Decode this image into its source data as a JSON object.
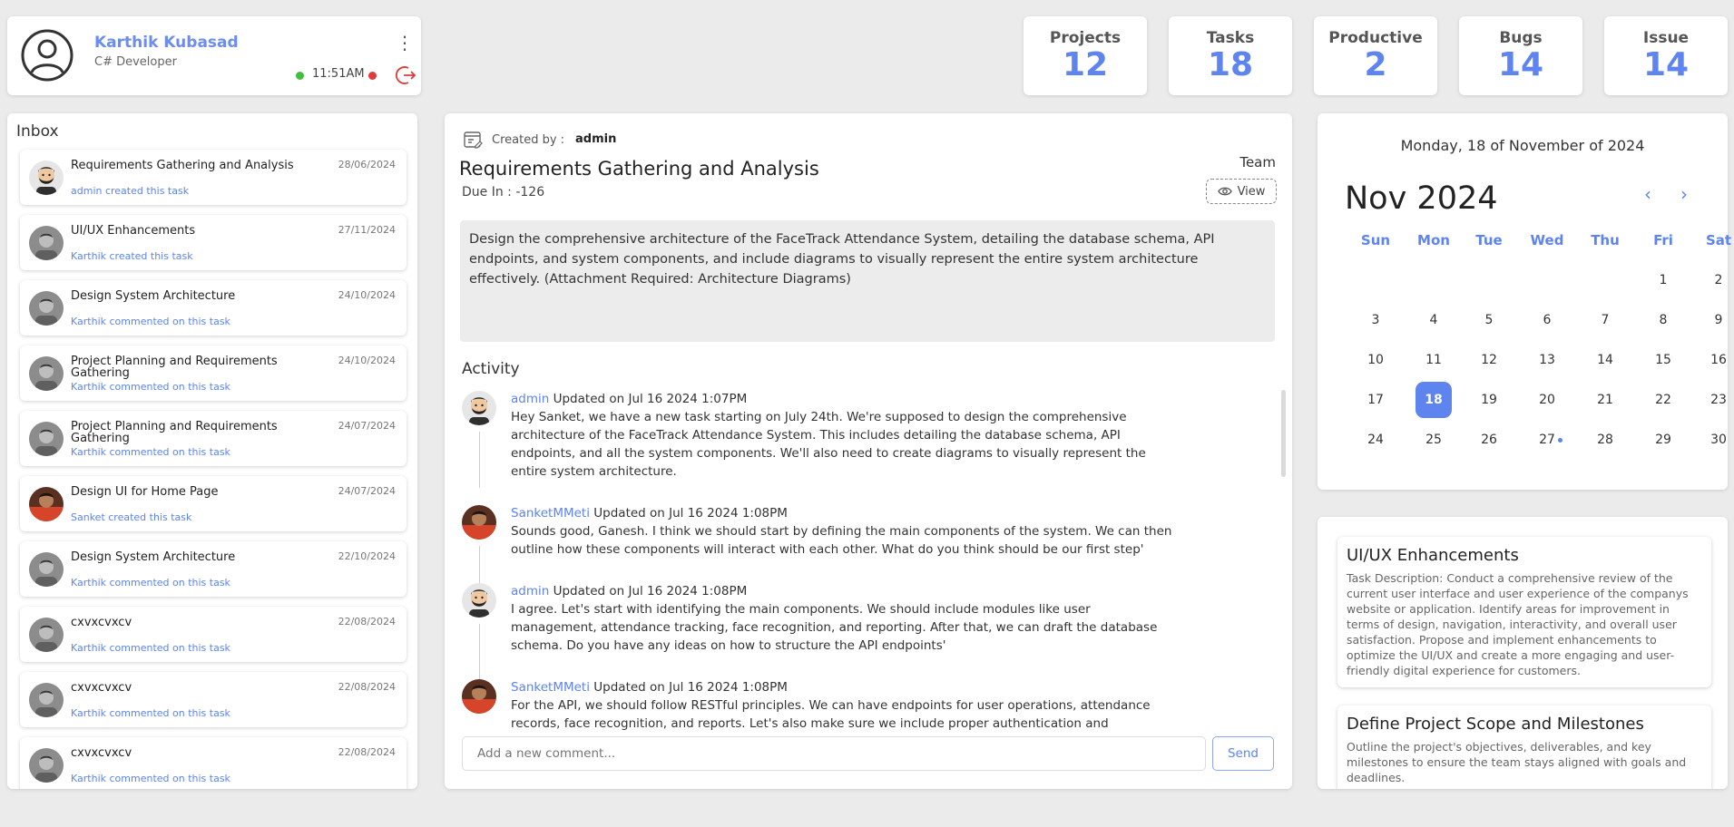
{
  "profile": {
    "name": "Karthik Kubasad",
    "role": "C# Developer",
    "time": "11:51AM"
  },
  "stats": [
    {
      "label": "Projects",
      "value": "12"
    },
    {
      "label": "Tasks",
      "value": "18"
    },
    {
      "label": "Productive",
      "value": "2"
    },
    {
      "label": "Bugs",
      "value": "14"
    },
    {
      "label": "Issue",
      "value": "14"
    }
  ],
  "inbox": {
    "title": "Inbox",
    "items": [
      {
        "title": "Requirements Gathering and Analysis",
        "subtitle": "admin created this task",
        "date": "28/06/2024"
      },
      {
        "title": "UI/UX Enhancements",
        "subtitle": "Karthik created this task",
        "date": "27/11/2024"
      },
      {
        "title": "Design System Architecture",
        "subtitle": "Karthik commented on this task",
        "date": "24/10/2024"
      },
      {
        "title": "Project Planning and Requirements Gathering",
        "subtitle": "Karthik commented on this task",
        "date": "24/10/2024"
      },
      {
        "title": "Project Planning and Requirements Gathering",
        "subtitle": "Karthik commented on this task",
        "date": "24/07/2024"
      },
      {
        "title": "Design UI for Home Page",
        "subtitle": "Sanket created this task",
        "date": "24/07/2024"
      },
      {
        "title": "Design System Architecture",
        "subtitle": "Karthik commented on this task",
        "date": "22/10/2024"
      },
      {
        "title": "cxvxcvxcv",
        "subtitle": "Karthik commented on this task",
        "date": "22/08/2024"
      },
      {
        "title": "cxvxcvxcv",
        "subtitle": "Karthik commented on this task",
        "date": "22/08/2024"
      },
      {
        "title": "cxvxcvxcv",
        "subtitle": "Karthik commented on this task",
        "date": "22/08/2024"
      }
    ]
  },
  "task": {
    "created_label": "Created by :",
    "created_by": "admin",
    "title": "Requirements Gathering and Analysis",
    "due": "Due In : -126",
    "team_label": "Team",
    "view_label": "View",
    "description": "Design the comprehensive architecture of the FaceTrack Attendance System, detailing the database schema, API endpoints, and system components, and include diagrams to visually represent the entire system architecture effectively. (Attachment Required: Architecture Diagrams)",
    "activity_title": "Activity",
    "activity": [
      {
        "user": "admin",
        "meta": " Updated on Jul 16 2024 1:07PM",
        "text": "Hey Sanket, we have a new task starting on July 24th. We're supposed to design the comprehensive architecture of the FaceTrack Attendance System. This includes detailing the database schema, API endpoints, and all the system components. We'll also need to create diagrams to visually represent the entire system architecture."
      },
      {
        "user": "SanketMMeti",
        "meta": " Updated on Jul 16 2024 1:08PM",
        "text": "Sounds good, Ganesh. I think we should start by defining the main components of the system. We can then outline how these components will interact with each other. What do you think should be our first step'"
      },
      {
        "user": "admin",
        "meta": " Updated on Jul 16 2024 1:08PM",
        "text": "I agree. Let's start with identifying the main components. We should include modules like user management, attendance tracking, face recognition, and reporting. After that, we can draft the database schema. Do you have any ideas on how to structure the API endpoints'"
      },
      {
        "user": "SanketMMeti",
        "meta": " Updated on Jul 16 2024 1:08PM",
        "text": "For the API, we should follow RESTful principles. We can have endpoints for user operations, attendance records, face recognition, and reports. Let's also make sure we include proper authentication and authorization mechanisms."
      }
    ],
    "comment_placeholder": "Add a new comment...",
    "send_label": "Send"
  },
  "calendar": {
    "full_date": "Monday, 18 of November of 2024",
    "month_label": "Nov 2024",
    "weekdays": [
      "Sun",
      "Mon",
      "Tue",
      "Wed",
      "Thu",
      "Fri",
      "Sat"
    ],
    "first_weekday": 5,
    "days_in_month": 30,
    "today": 18,
    "event_days": [
      27
    ]
  },
  "task_cards": [
    {
      "title": "UI/UX Enhancements",
      "description": "Task Description: Conduct a comprehensive review of the current user interface and user experience of the companys website or application. Identify areas for improvement in terms of design, navigation, interactivity, and overall user satisfaction. Propose and implement enhancements to optimize the UI/UX and create a more engaging and user-friendly digital experience for customers."
    },
    {
      "title": "Define Project Scope and Milestones",
      "description": "Outline the project's objectives, deliverables, and key milestones to ensure the team stays aligned with goals and deadlines."
    }
  ],
  "colors": {
    "accent": "#5d84ef",
    "online": "#3fc13c",
    "danger": "#e03a3a"
  }
}
